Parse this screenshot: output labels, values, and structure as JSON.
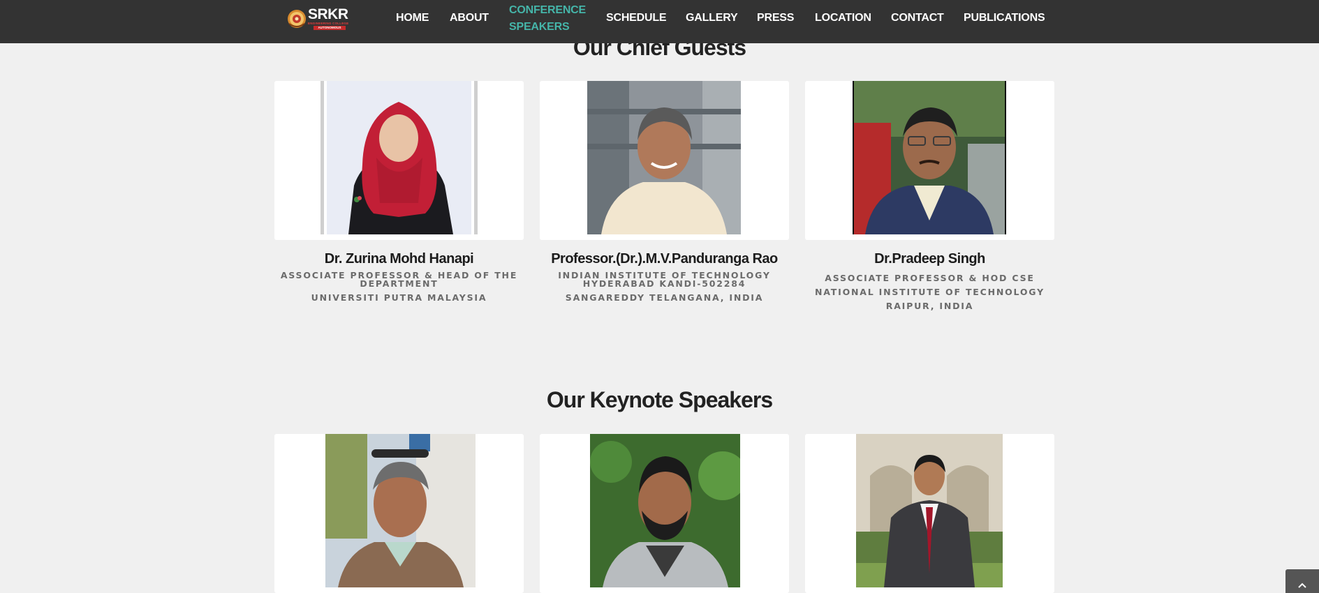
{
  "nav": {
    "logo": {
      "main": "SRKR",
      "line1": "ENGINEERING COLLEGE",
      "line2": "AUTONOMOUS"
    },
    "items": [
      {
        "label": "HOME"
      },
      {
        "label": "ABOUT"
      },
      {
        "label_line1": "CONFERENCE",
        "label_line2": "SPEAKERS",
        "active": true
      },
      {
        "label": "SCHEDULE"
      },
      {
        "label": "GALLERY"
      },
      {
        "label": "PRESS"
      },
      {
        "label": "LOCATION"
      },
      {
        "label": "CONTACT"
      },
      {
        "label": "PUBLICATIONS"
      }
    ],
    "colors": {
      "bar": "#333333",
      "active": "#45b5a9"
    }
  },
  "chief_guests": {
    "title": "Our Chief Guests",
    "people": [
      {
        "name": "Dr. Zurina Mohd Hanapi",
        "line1": "ASSOCIATE PROFESSOR & HEAD OF THE DEPARTMENT",
        "line2": "UNIVERSITI PUTRA MALAYSIA",
        "photo": "woman-red-hijab-portrait"
      },
      {
        "name": "Professor.(Dr.).M.V.Panduranga Rao",
        "line1": "INDIAN INSTITUTE OF TECHNOLOGY HYDERABAD KANDI-502284",
        "line2": "SANGAREDDY TELANGANA, INDIA",
        "photo": "man-grey-hair-cream-shirt-portrait"
      },
      {
        "name": "Dr.Pradeep Singh",
        "line1": "ASSOCIATE PROFESSOR & HOD CSE",
        "line2": "NATIONAL INSTITUTE OF TECHNOLOGY RAIPUR, INDIA",
        "photo": "man-glasses-blazer-portrait"
      }
    ]
  },
  "keynote_speakers": {
    "title": "Our Keynote Speakers",
    "people": [
      {
        "photo": "man-sunglasses-on-head-portrait"
      },
      {
        "photo": "man-beard-grey-blazer-portrait"
      },
      {
        "photo": "man-dark-suit-red-tie-portrait"
      }
    ]
  },
  "scroll_top": {
    "icon": "chevron-up-icon",
    "glyph": "⌃"
  }
}
